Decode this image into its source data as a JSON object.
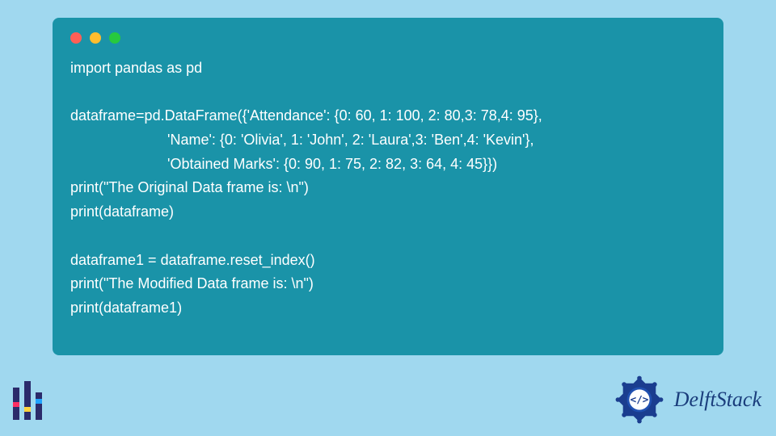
{
  "code": {
    "lines": [
      "import pandas as pd",
      "",
      "dataframe=pd.DataFrame({'Attendance': {0: 60, 1: 100, 2: 80,3: 78,4: 95},",
      "                        'Name': {0: 'Olivia', 1: 'John', 2: 'Laura',3: 'Ben',4: 'Kevin'},",
      "                        'Obtained Marks': {0: 90, 1: 75, 2: 82, 3: 64, 4: 45}})",
      "print(\"The Original Data frame is: \\n\")",
      "print(dataframe)",
      "",
      "dataframe1 = dataframe.reset_index()",
      "print(\"The Modified Data frame is: \\n\")",
      "print(dataframe1)"
    ]
  },
  "brand": {
    "name": "DelftStack"
  },
  "window": {
    "controls": [
      "red",
      "yellow",
      "green"
    ]
  }
}
